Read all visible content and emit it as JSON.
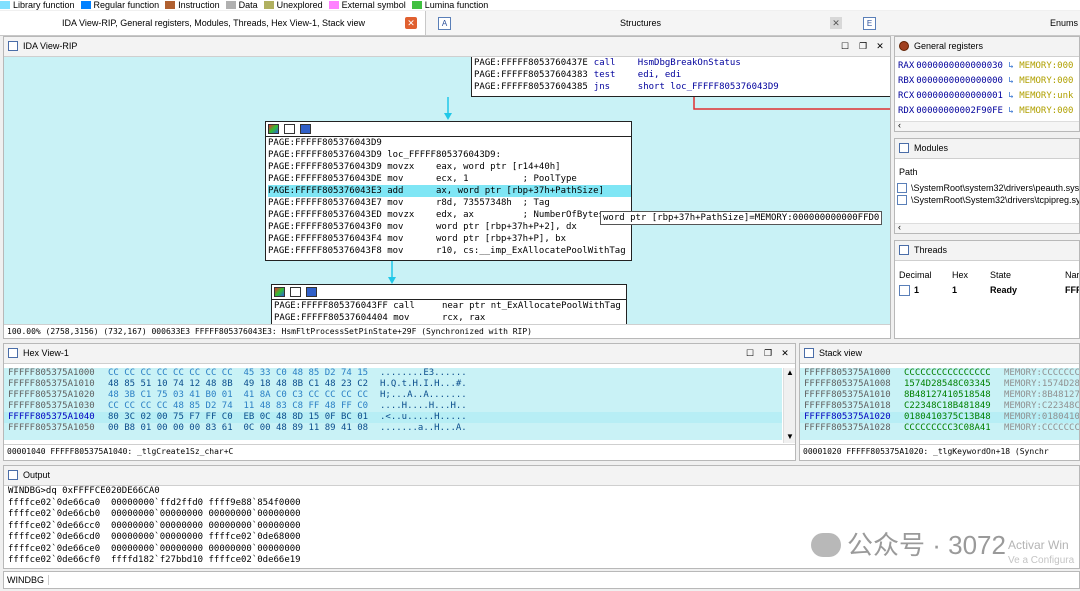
{
  "legend": [
    {
      "label": "Library function",
      "color": "#80e0ff"
    },
    {
      "label": "Regular function",
      "color": "#0080ff"
    },
    {
      "label": "Instruction",
      "color": "#b06030"
    },
    {
      "label": "Data",
      "color": "#b0b0b0"
    },
    {
      "label": "Unexplored",
      "color": "#b0b060"
    },
    {
      "label": "External symbol",
      "color": "#ff80ff"
    },
    {
      "label": "Lumina function",
      "color": "#40c040"
    }
  ],
  "tabs": {
    "main": "IDA View-RIP, General registers, Modules, Threads, Hex View-1, Stack view",
    "structures": "Structures",
    "enums": "Enums"
  },
  "ida_view": {
    "title": "IDA View-RIP",
    "top_block": [
      {
        "addr": "PAGE:FFFFF8053760437E",
        "mn": "call",
        "ops": "HsmDbgBreakOnStatus"
      },
      {
        "addr": "PAGE:FFFFF80537604383",
        "mn": "test",
        "ops": "edi, edi"
      },
      {
        "addr": "PAGE:FFFFF80537604385",
        "mn": "jns",
        "ops": "short loc_FFFFF805376043D9"
      }
    ],
    "mid_block": [
      {
        "text": "PAGE:FFFFF805376043D9",
        "hl": false
      },
      {
        "text": "PAGE:FFFFF805376043D9 loc_FFFFF805376043D9:",
        "hl": false
      },
      {
        "text": "PAGE:FFFFF805376043D9 movzx    eax, word ptr [r14+40h]",
        "hl": false
      },
      {
        "text": "PAGE:FFFFF805376043DE mov      ecx, 1          ; PoolType",
        "hl": false
      },
      {
        "text": "PAGE:FFFFF805376043E3 add      ax, word ptr [rbp+37h+PathSize]",
        "hl": true
      },
      {
        "text": "PAGE:FFFFF805376043E7 mov      r8d, 73557348h  ; Tag",
        "hl": false
      },
      {
        "text": "PAGE:FFFFF805376043ED movzx    edx, ax         ; NumberOfBytes",
        "hl": false
      },
      {
        "text": "PAGE:FFFFF805376043F0 mov      word ptr [rbp+37h+P+2], dx",
        "hl": false
      },
      {
        "text": "PAGE:FFFFF805376043F4 mov      word ptr [rbp+37h+P], bx",
        "hl": false
      },
      {
        "text": "PAGE:FFFFF805376043F8 mov      r10, cs:__imp_ExAllocatePoolWithTag",
        "hl": false
      }
    ],
    "bottom_block": [
      "PAGE:FFFFF805376043FF call     near ptr nt_ExAllocatePoolWithTag",
      "PAGE:FFFFF80537604404 mov      rcx, rax"
    ],
    "tooltip": "word ptr [rbp+37h+PathSize]=MEMORY:000000000000FFD0",
    "status": "100.00% (2758,3156) (732,167) 000633E3 FFFFF805376043E3: HsmFltProcessSetPinState+29F (Synchronized with RIP)"
  },
  "registers": {
    "title": "General registers",
    "rows": [
      {
        "name": "RAX",
        "value": "0000000000000030",
        "ref": "MEMORY:000"
      },
      {
        "name": "RBX",
        "value": "0000000000000000",
        "ref": "MEMORY:000"
      },
      {
        "name": "RCX",
        "value": "0000000000000001",
        "ref": "MEMORY:unk"
      },
      {
        "name": "RDX",
        "value": "00000000002F90FE",
        "ref": "MEMORY:000"
      }
    ]
  },
  "modules": {
    "title": "Modules",
    "header": "Path",
    "rows": [
      "\\SystemRoot\\system32\\drivers\\peauth.sys",
      "\\SystemRoot\\System32\\drivers\\tcpipreg.sys"
    ]
  },
  "threads": {
    "title": "Threads",
    "cols": [
      "Decimal",
      "Hex",
      "State",
      "Nar"
    ],
    "row": {
      "decimal": "1",
      "hex": "1",
      "state": "Ready",
      "name": "FFFF"
    }
  },
  "hexview": {
    "title": "Hex View-1",
    "rows": [
      {
        "addr": "FFFFF805375A1000",
        "bytes": "CC CC CC CC CC CC CC CC  45 33 C0 48 85 D2 74 15",
        "ascii": "........E3......",
        "hl": false
      },
      {
        "addr": "FFFFF805375A1010",
        "bytes": "48 85 51 10 74 12 48 8B  49 18 48 8B C1 48 23 C2",
        "ascii": "H.Q.t.H.I.H...#.",
        "hl": false
      },
      {
        "addr": "FFFFF805375A1020",
        "bytes": "48 3B C1 75 03 41 B0 01  41 8A C0 C3 CC CC CC CC",
        "ascii": "H;...A..A.......",
        "hl": false
      },
      {
        "addr": "FFFFF805375A1030",
        "bytes": "CC CC CC CC 48 85 D2 74  11 48 83 C8 FF 48 FF C0",
        "ascii": "....H....H...H..",
        "hl": false
      },
      {
        "addr": "FFFFF805375A1040",
        "bytes": "80 3C 02 00 75 F7 FF C0  EB 0C 48 8D 15 0F BC 01",
        "ascii": ".<..u.....H.....",
        "hl": true
      },
      {
        "addr": "FFFFF805375A1050",
        "bytes": "00 B8 01 00 00 00 83 61  0C 00 48 89 11 89 41 08",
        "ascii": ".......a..H...A.",
        "hl": false
      }
    ],
    "status": "00001040 FFFFF805375A1040: _tlgCreate1Sz_char+C"
  },
  "stack": {
    "title": "Stack view",
    "rows": [
      {
        "addr": "FFFFF805375A1000",
        "val": "CCCCCCCCCCCCCCCC",
        "ref": "MEMORY:CCCCCCCC",
        "hl": false
      },
      {
        "addr": "FFFFF805375A1008",
        "val": "1574D28548C03345",
        "ref": "MEMORY:1574D285",
        "hl": false
      },
      {
        "addr": "FFFFF805375A1010",
        "val": "8B48127410518548",
        "ref": "MEMORY:8B481274",
        "hl": false
      },
      {
        "addr": "FFFFF805375A1018",
        "val": "C22348C18B481849",
        "ref": "MEMORY:C22348C1",
        "hl": false
      },
      {
        "addr": "FFFFF805375A1020",
        "val": "0180410375C13B48",
        "ref": "MEMORY:01804103",
        "hl": true
      },
      {
        "addr": "FFFFF805375A1028",
        "val": "CCCCCCCCC3C08A41",
        "ref": "MEMORY:CCCCCCCC",
        "hl": false
      }
    ],
    "status": "00001020 FFFFF805375A1020: _tlgKeywordOn+18 (Synchr"
  },
  "output": {
    "title": "Output",
    "lines": [
      "WINDBG>dq 0xFFFFCE020DE66CA0",
      "ffffce02`0de66ca0  00000000`ffd2ffd0 ffff9e88`854f0000",
      "ffffce02`0de66cb0  00000000`00000000 00000000`00000000",
      "ffffce02`0de66cc0  00000000`00000000 00000000`00000000",
      "ffffce02`0de66cd0  00000000`00000000 ffffce02`0de68000",
      "ffffce02`0de66ce0  00000000`00000000 00000000`00000000",
      "ffffce02`0de66cf0  ffffd182`f27bbd10 ffffce02`0de66e19"
    ],
    "watermark": "公众号 · 3072",
    "activation": "Activar Win",
    "activation2": "Ve a Configura"
  },
  "cmdbar": {
    "label": "WINDBG",
    "value": ""
  }
}
